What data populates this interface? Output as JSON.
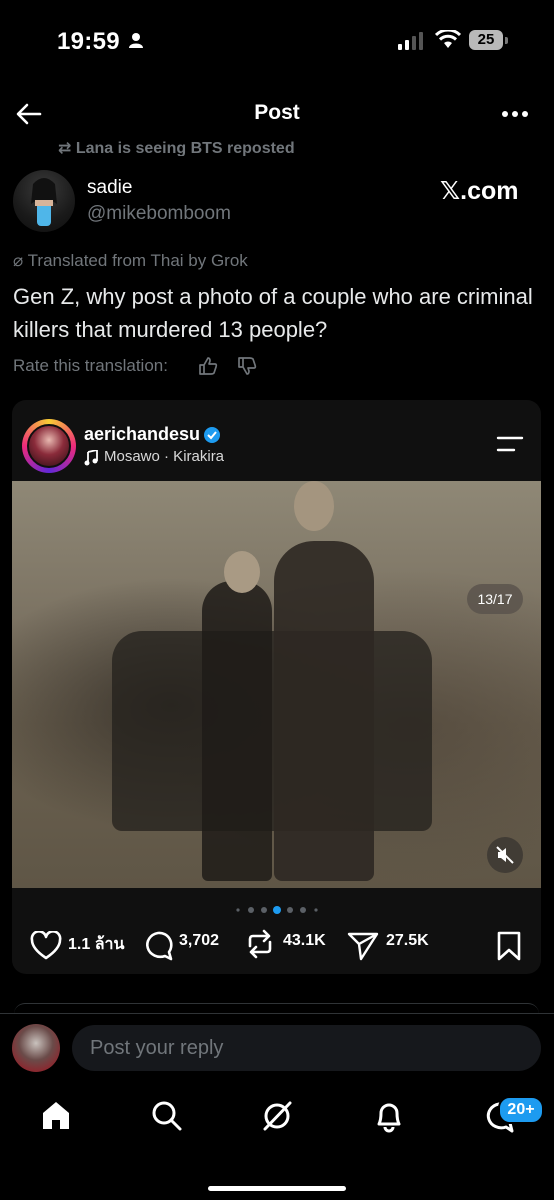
{
  "status_bar": {
    "time": "19:59",
    "battery": "25"
  },
  "header": {
    "title": "Post"
  },
  "repost": {
    "text": "Lana is seeing BTS reposted"
  },
  "author": {
    "name": "sadie",
    "handle": "@mikebomboom",
    "source_label": "𝕏.com"
  },
  "post": {
    "translated_label": "Translated from Thai by Grok",
    "text": "Gen Z, why post a photo of a couple who are criminal killers that murdered 13 people?",
    "rate_label": "Rate this translation:"
  },
  "embed": {
    "username": "aerichandesu",
    "music": "Mosawo · Kirakira",
    "counter": "13/17",
    "carousel": {
      "total_dots": 7,
      "active_index": 3
    },
    "stats": {
      "likes": "1.1 ล้าน",
      "comments": "3,702",
      "reposts": "43.1K",
      "shares": "27.5K"
    }
  },
  "reply": {
    "placeholder": "Post your reply"
  },
  "nav": {
    "notifications_badge": "20+"
  },
  "colors": {
    "background": "#000000",
    "accent": "#1d9bf0",
    "muted": "#71767b",
    "text": "#e7e9ea"
  },
  "icons": [
    "back-arrow-icon",
    "more-icon",
    "repost-icon",
    "grok-icon",
    "thumb-up-icon",
    "thumb-down-icon",
    "verified-icon",
    "music-note-icon",
    "menu-icon",
    "mute-icon",
    "heart-icon",
    "comment-icon",
    "repost-icon",
    "send-icon",
    "bookmark-icon",
    "home-icon",
    "search-icon",
    "grok-icon",
    "bell-icon",
    "messages-icon"
  ]
}
